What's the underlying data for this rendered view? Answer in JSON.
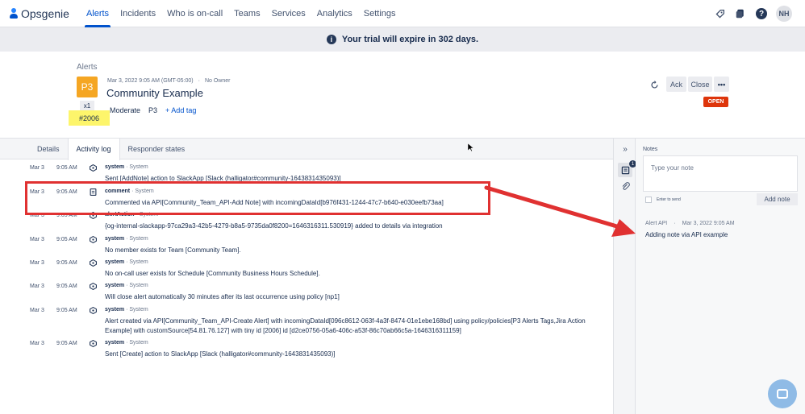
{
  "app": {
    "name": "Opsgenie"
  },
  "nav": {
    "items": [
      "Alerts",
      "Incidents",
      "Who is on-call",
      "Teams",
      "Services",
      "Analytics",
      "Settings"
    ],
    "active": "Alerts",
    "avatar_initials": "NH"
  },
  "banner": {
    "text": "Your trial will expire in 302 days."
  },
  "alert": {
    "breadcrumb": "Alerts",
    "priority": "P3",
    "count": "x1",
    "tiny_id": "#2006",
    "created": "Mar 3, 2022 9:05 AM (GMT-05:00)",
    "owner": "No Owner",
    "title": "Community Example",
    "severity": "Moderate",
    "tag": "P3",
    "add_tag": "+ Add tag",
    "status": "OPEN",
    "actions": {
      "ack": "Ack",
      "close": "Close",
      "more": "•••"
    }
  },
  "tabs": [
    "Details",
    "Activity log",
    "Responder states"
  ],
  "active_tab": "Activity log",
  "activity_log": [
    {
      "date": "Mar 3",
      "time": "9:05 AM",
      "who": "system",
      "via": "System",
      "message": "Sent [AddNote] action to SlackApp [Slack (halligator#community-1643831435093)]"
    },
    {
      "date": "Mar 3",
      "time": "9:05 AM",
      "who": "comment",
      "via": "System",
      "message": "Commented via API[Community_Team_API-Add Note] with incomingDataId[b976f431-1244-47c7-b640-e030eefb73aa]"
    },
    {
      "date": "Mar 3",
      "time": "9:05 AM",
      "who": "alertAction",
      "via": "System",
      "message": "{og-internal-slackapp-97ca29a3-42b5-4279-b8a5-9735da0f8200=1646316311.530919} added to details via integration"
    },
    {
      "date": "Mar 3",
      "time": "9:05 AM",
      "who": "system",
      "via": "System",
      "message": "No member exists for Team [Community Team]."
    },
    {
      "date": "Mar 3",
      "time": "9:05 AM",
      "who": "system",
      "via": "System",
      "message": "No on-call user exists for Schedule [Community Business Hours Schedule]."
    },
    {
      "date": "Mar 3",
      "time": "9:05 AM",
      "who": "system",
      "via": "System",
      "message": "Will close alert automatically 30 minutes after its last occurrence using policy [np1]"
    },
    {
      "date": "Mar 3",
      "time": "9:05 AM",
      "who": "system",
      "via": "System",
      "message": "Alert created via API[Community_Team_API-Create Alert] with incomingDataId[096c8612-063f-4a3f-8474-01e1ebe168bd] using policy/policies[P3 Alerts Tags,Jira Action Example] with customSource[54.81.76.127] with tiny id [2006] id [d2ce0756-05a6-406c-a53f-86c70ab66c5a-1646316311159]"
    },
    {
      "date": "Mar 3",
      "time": "9:05 AM",
      "who": "system",
      "via": "System",
      "message": "Sent [Create] action to SlackApp [Slack (halligator#community-1643831435093)]"
    }
  ],
  "notes": {
    "label": "Notes",
    "placeholder": "Type your note",
    "enter_to_send": "Enter to send",
    "add_button": "Add note",
    "badge_count": "1",
    "items": [
      {
        "author": "Alert API",
        "time": "Mar 3, 2022 9:05 AM",
        "text": "Adding note via API example"
      }
    ]
  },
  "colors": {
    "accent": "#0052cc",
    "priority": "#f5a623",
    "status_open": "#de350b",
    "annotation": "#e03131",
    "highlight": "#fdf56b"
  }
}
